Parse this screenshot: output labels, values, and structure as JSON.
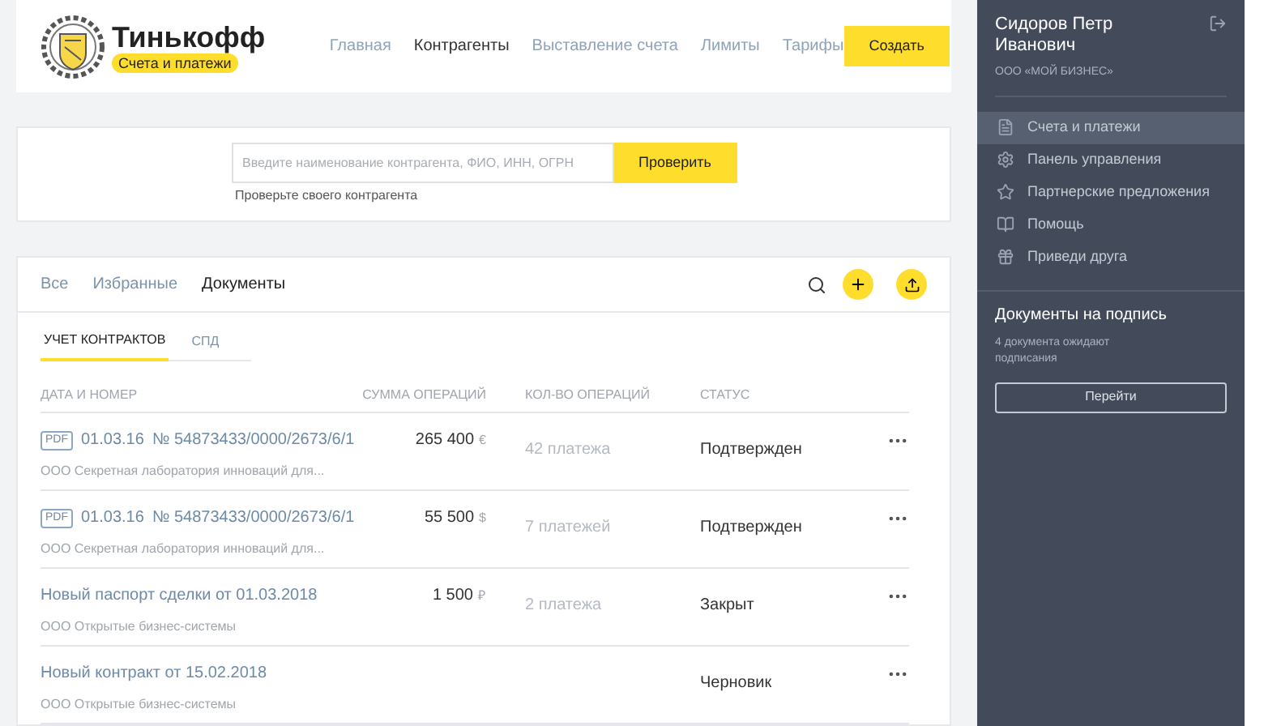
{
  "logo": {
    "name": "Тинькофф",
    "badge": "Счета и платежи"
  },
  "nav": [
    {
      "label": "Главная",
      "selected": false
    },
    {
      "label": "Контрагенты",
      "selected": true
    },
    {
      "label": "Выставление счета",
      "selected": false
    },
    {
      "label": "Лимиты",
      "selected": false
    },
    {
      "label": "Тарифы",
      "selected": false
    }
  ],
  "create_button": "Создать",
  "check": {
    "placeholder": "Введите наименование контрагента, ФИО, ИНН, ОГРН",
    "button": "Проверить",
    "hint": "Проверьте своего контрагента"
  },
  "tabs": [
    {
      "label": "Все",
      "selected": false
    },
    {
      "label": "Избранные",
      "selected": false
    },
    {
      "label": "Документы",
      "selected": true
    }
  ],
  "subtabs": [
    {
      "label": "УЧЕТ КОНТРАКТОВ",
      "selected": true
    },
    {
      "label": "СПД",
      "selected": false
    }
  ],
  "table": {
    "columns": [
      "ДАТА И НОМЕР",
      "СУММА ОПЕРАЦИЙ",
      "КОЛ-ВО ОПЕРАЦИЙ",
      "СТАТУС"
    ],
    "rows": [
      {
        "pdf": "PDF",
        "date": "01.03.16",
        "title": "№ 54873433/0000/2673/6/1",
        "company": "ООО Секретная лаборатория инноваций для...",
        "sum": "265 400",
        "currency": "€",
        "count": "42 платежа",
        "status": "Подтвержден"
      },
      {
        "pdf": "PDF",
        "date": "01.03.16",
        "title": "№ 54873433/0000/2673/6/1",
        "company": "ООО Секретная лаборатория инноваций для...",
        "sum": "55 500",
        "currency": "$",
        "count": "7 платежей",
        "status": "Подтвержден"
      },
      {
        "title": "Новый паспорт сделки от 01.03.2018",
        "company": "ООО Открытые бизнес-системы",
        "sum": "1 500",
        "currency": "₽",
        "count": "2 платежа",
        "status": "Закрыт"
      },
      {
        "title": "Новый контракт от 15.02.2018",
        "company": "ООО Открытые бизнес-системы",
        "status": "Черновик"
      }
    ]
  },
  "sidebar": {
    "user": "Сидоров Петр Иванович",
    "company": "ООО «МОЙ БИЗНЕС»",
    "items": [
      {
        "label": "Счета и платежи",
        "selected": true
      },
      {
        "label": "Панель управления",
        "selected": false
      },
      {
        "label": "Партнерские предложения",
        "selected": false
      },
      {
        "label": "Помощь",
        "selected": false
      },
      {
        "label": "Приведи друга",
        "selected": false
      }
    ],
    "sign": {
      "title": "Документы на подпись",
      "text": "4 документа ожидают подписания",
      "button": "Перейти"
    }
  }
}
